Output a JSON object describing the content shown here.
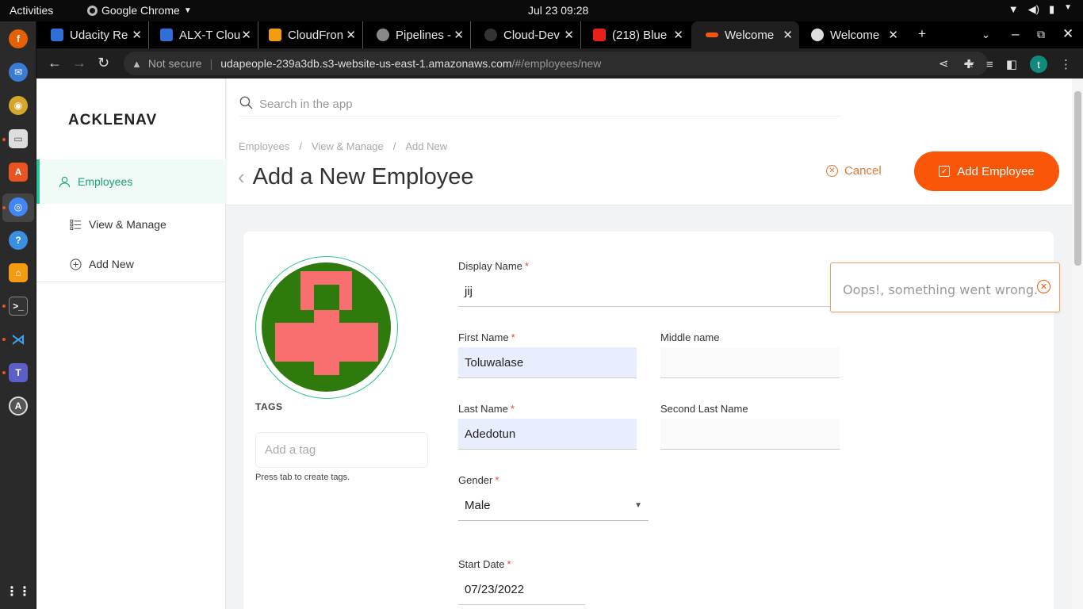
{
  "system": {
    "activities": "Activities",
    "app_name": "Google Chrome",
    "clock": "Jul 23  09:28"
  },
  "tabs": [
    {
      "title": "Udacity Re",
      "fav_color": "#2f6fd6"
    },
    {
      "title": "ALX-T Clou",
      "fav_color": "#2f6fd6"
    },
    {
      "title": "CloudFron",
      "fav_color": "#f39c12"
    },
    {
      "title": "Pipelines -",
      "fav_color": "#888888"
    },
    {
      "title": "Cloud-Dev",
      "fav_color": "#333333"
    },
    {
      "title": "(218) Blue",
      "fav_color": "#e62117"
    },
    {
      "title": "Welcome",
      "fav_color": "#f9560a"
    },
    {
      "title": "Welcome",
      "fav_color": "#dddddd"
    }
  ],
  "omnibox": {
    "security": "Not secure",
    "host": "udapeople-239a3db.s3-website-us-east-1.amazonaws.com",
    "path": "/#/employees/new"
  },
  "profile_initial": "t",
  "app": {
    "logo": "ACKLENAV",
    "nav": [
      {
        "label": "Employees"
      },
      {
        "label": "View & Manage"
      },
      {
        "label": "Add New"
      }
    ],
    "search_placeholder": "Search in the app",
    "breadcrumbs": [
      "Employees",
      "/",
      "View & Manage",
      "/",
      "Add New"
    ],
    "page_title": "Add a New Employee",
    "cancel_label": "Cancel",
    "add_label": "Add Employee"
  },
  "form": {
    "tags_label": "TAGS",
    "tag_placeholder": "Add a tag",
    "tag_hint": "Press tab to create tags.",
    "display_name": {
      "label": "Display Name",
      "value": "jij"
    },
    "first_name": {
      "label": "First Name",
      "value": "Toluwalase"
    },
    "middle_name": {
      "label": "Middle name",
      "value": ""
    },
    "last_name": {
      "label": "Last Name",
      "value": "Adedotun"
    },
    "second_last_name": {
      "label": "Second Last Name",
      "value": ""
    },
    "gender": {
      "label": "Gender",
      "value": "Male"
    },
    "start_date": {
      "label": "Start Date",
      "value": "07/23/2022"
    },
    "required_mark": "*"
  },
  "toast": {
    "message": "Oops!, something went wrong."
  },
  "colors": {
    "accent": "#f9560a",
    "nav_active": "#2dc29a"
  }
}
